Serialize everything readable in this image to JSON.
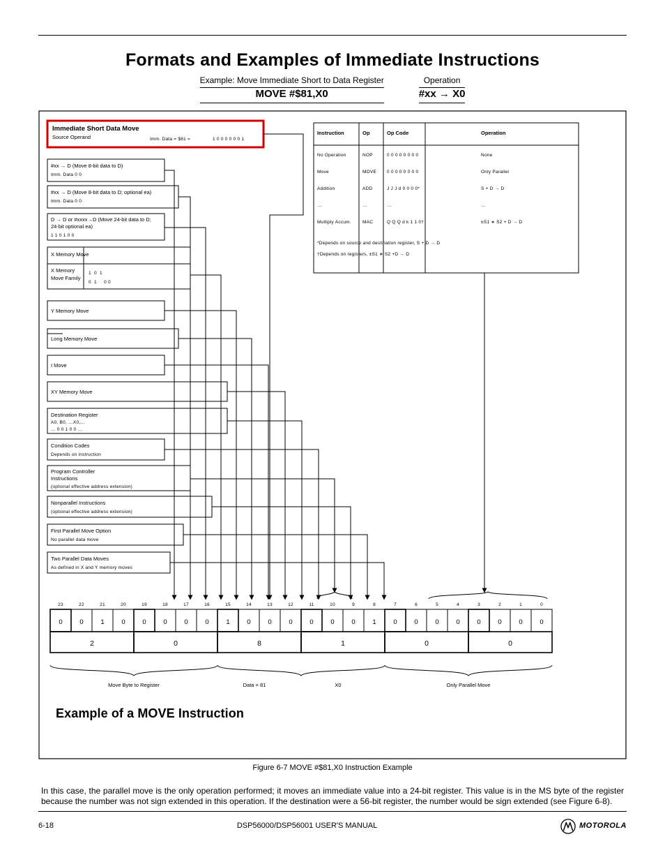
{
  "header_title": "Formats and Examples of Immediate Instructions",
  "subhdr": {
    "left_top": "Example: Move Immediate Short to Data Register",
    "left_bot": "MOVE  #$81,X0",
    "right_top": "Operation",
    "right_bot": "#xx → X0"
  },
  "boxes": {
    "red": [
      "Immediate Short Data Move",
      "Source Operand"
    ],
    "imm_sub": "Imm. Data = $81 =",
    "b1": [
      "#xx → D (Move 8-bit data to D)",
      "Imm. Data 0 0"
    ],
    "b2": [
      "#xx → D (Move 8-bit data to D; optional ea)",
      "Imm. Data 0 0"
    ],
    "b3": [
      "D → D or #xxxx→D (Move 24-bit data to D; ",
      "24-bit optional ea)",
      "1 1 0 1 0 0"
    ],
    "b4a": [
      "X Memory Move",
      " "
    ],
    "b4b": [
      "X Memory",
      "Move Family"
    ],
    "b4body": [
      [
        "1",
        "0",
        "1",
        " "
      ],
      [
        "0",
        "1",
        " ",
        "0 0"
      ]
    ],
    "b5": [
      "Y Memory Move",
      " "
    ],
    "b6": [
      "Long Memory Move",
      " "
    ],
    "b7": [
      "I Move",
      " "
    ],
    "b8": [
      "XY Memory Move",
      " "
    ],
    "b9": [
      "Destination Register",
      "A0, B0, …X0,…",
      "… 0 0 1 0 0 …"
    ],
    "b10": [
      "Condition Codes",
      "Depends on instruction"
    ],
    "b11": [
      "Program Controller",
      "Instructions",
      "(optional effective address extension)"
    ],
    "b12": [
      "Nonparallel Instructions",
      "(optional effective address extension)"
    ],
    "b13": [
      "First Parallel Move Option",
      "No parallel data move"
    ],
    "b14": [
      "Two Parallel Data Moves",
      "As defined in X and Y memory moves"
    ]
  },
  "side_table": {
    "instr_col": [
      "No Operation",
      "Move",
      "Addition",
      "…",
      "Multiply Accum."
    ],
    "op_col": [
      "NOP",
      "MOVE",
      "ADD",
      "…",
      "MAC"
    ],
    "code_col": [
      "0 0 0 0 0 0 0 0",
      "0 0 0 0 0 0 0 0",
      "J J J d 0 0 0 0*",
      "…",
      "Q Q Q d k 1 1 0†"
    ],
    "oper_col": [
      "None",
      "Only Parallel",
      "S + D → D",
      "…",
      "±S1 ∗ S2 + D → D"
    ],
    "note1": "*Depends on source and destination register, S + D → D",
    "note2": "†Depends on registers, ±S1 ∗ S2 +D → D"
  },
  "final": {
    "hex_heading": [
      "2",
      "0",
      "8",
      "1",
      "0",
      "0"
    ],
    "bits": [
      "0",
      "0",
      "1",
      "0",
      "0",
      "0",
      "0",
      "0",
      "1",
      "0",
      "0",
      "0",
      "0",
      "0",
      "0",
      "1",
      "0",
      "0",
      "0",
      "0",
      "0",
      "0",
      "0",
      "0"
    ],
    "groups": [
      "Move Byte to Register",
      "Data = 81",
      "X0",
      "Only Parallel Move"
    ]
  },
  "example_title": "Example of a MOVE Instruction",
  "fig": "Figure 6-7  MOVE #$81,X0 Instruction Example",
  "caption1": "In this case, the parallel move is the only operation performed; it moves an immediate value into a 24-bit register. This value is in the MS byte of the register because the number was not sign extended in this operation. If the destination were a 56-bit register, the number would be sign extended (see Figure 6-8).",
  "footer": {
    "page": "6-18",
    "title": "DSP56000/DSP56001 USER'S MANUAL",
    "logo": "MOTOROLA"
  }
}
